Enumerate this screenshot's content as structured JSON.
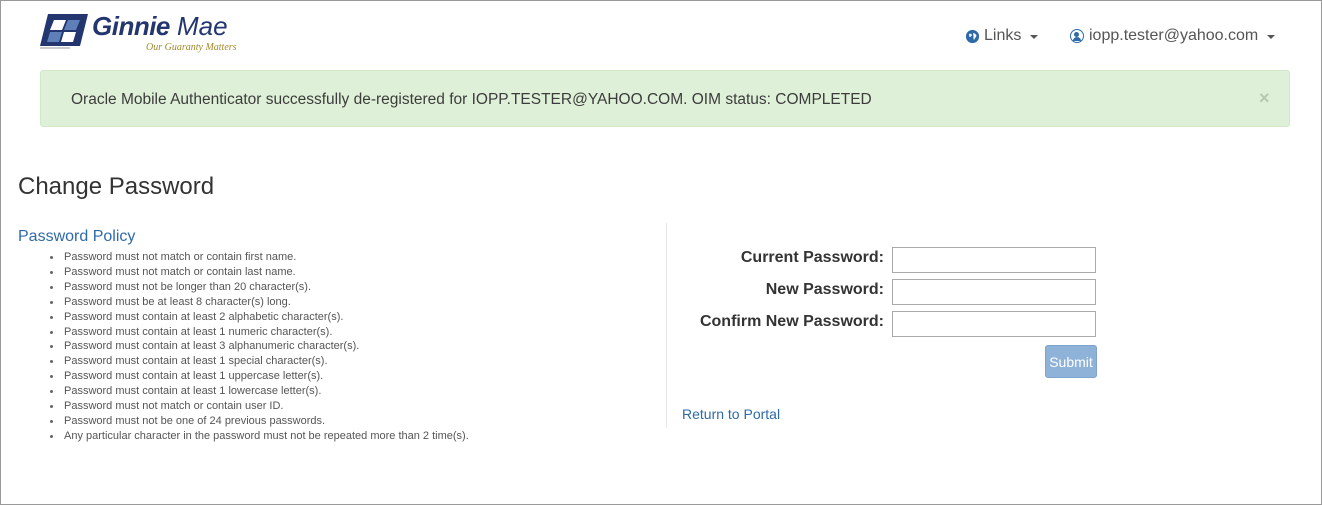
{
  "header": {
    "logo": {
      "brand_bold": "Ginnie",
      "brand_light": "Mae",
      "tagline": "Our Guaranty Matters"
    },
    "links_label": "Links",
    "links_icon": "globe-icon",
    "user_label": "iopp.tester@yahoo.com",
    "user_icon": "user-circle-icon"
  },
  "alert": {
    "message": "Oracle Mobile Authenticator successfully de-registered for IOPP.TESTER@YAHOO.COM. OIM status: COMPLETED",
    "close_symbol": "×",
    "color": "#dff0d8"
  },
  "page": {
    "title": "Change Password"
  },
  "policy": {
    "heading": "Password Policy",
    "items": [
      "Password must not match or contain first name.",
      "Password must not match or contain last name.",
      "Password must not be longer than 20 character(s).",
      "Password must be at least 8 character(s) long.",
      "Password must contain at least 2 alphabetic character(s).",
      "Password must contain at least 1 numeric character(s).",
      "Password must contain at least 3 alphanumeric character(s).",
      "Password must contain at least 1 special character(s).",
      "Password must contain at least 1 uppercase letter(s).",
      "Password must contain at least 1 lowercase letter(s).",
      "Password must not match or contain user ID.",
      "Password must not be one of 24 previous passwords.",
      "Any particular character in the password must not be repeated more than 2 time(s)."
    ]
  },
  "form": {
    "current_password_label": "Current Password:",
    "new_password_label": "New Password:",
    "confirm_password_label": "Confirm New Password:",
    "current_password_value": "",
    "new_password_value": "",
    "confirm_password_value": "",
    "submit_label": "Submit",
    "return_link": "Return to Portal"
  },
  "colors": {
    "brand_blue": "#23366f",
    "link_blue": "#2f6aa8",
    "submit_blue": "#8fb2d8"
  }
}
